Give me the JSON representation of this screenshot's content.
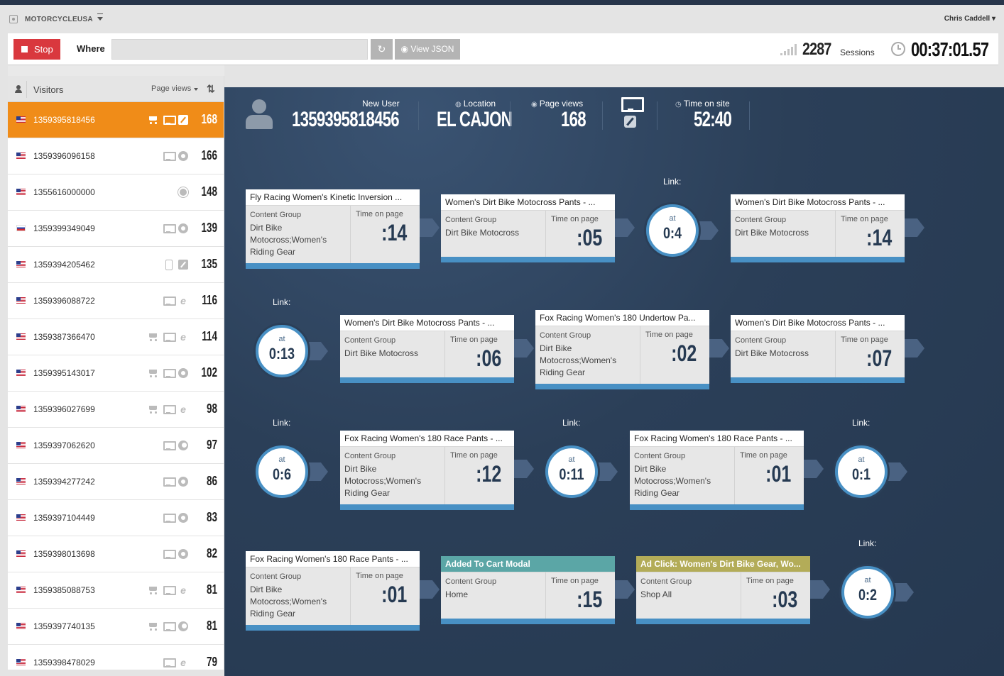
{
  "app": {
    "site_name": "MOTORCYCLEUSA",
    "user_name": "Chris Caddell ▾"
  },
  "controls": {
    "stop_label": "Stop",
    "where_label": "Where",
    "where_value": "",
    "view_json_label": "View JSON",
    "sessions_count": "2287",
    "sessions_label": "Sessions",
    "elapsed": "00:37:01.57"
  },
  "sidebar": {
    "title": "Visitors",
    "sort_label": "Page views",
    "order_icon": "⇅",
    "visitors": [
      {
        "id": "1359395818456",
        "flag": "us",
        "icons": [
          "cart-icon",
          "desktop-icon",
          "safari-icon"
        ],
        "count": "168"
      },
      {
        "id": "1359396096158",
        "flag": "us",
        "icons": [
          "desktop-icon",
          "chrome-icon"
        ],
        "count": "166"
      },
      {
        "id": "1355616000000",
        "flag": "us",
        "icons": [
          "gear-icon"
        ],
        "count": "148"
      },
      {
        "id": "1359399349049",
        "flag": "ru",
        "icons": [
          "desktop-icon",
          "chrome-icon"
        ],
        "count": "139"
      },
      {
        "id": "1359394205462",
        "flag": "us",
        "icons": [
          "tablet-icon",
          "safari-icon"
        ],
        "count": "135"
      },
      {
        "id": "1359396088722",
        "flag": "us",
        "icons": [
          "desktop-icon",
          "ie-icon"
        ],
        "count": "116"
      },
      {
        "id": "1359387366470",
        "flag": "us",
        "icons": [
          "cart-icon",
          "desktop-icon",
          "ie-icon"
        ],
        "count": "114"
      },
      {
        "id": "1359395143017",
        "flag": "us",
        "icons": [
          "cart-icon",
          "desktop-icon",
          "chrome-icon"
        ],
        "count": "102"
      },
      {
        "id": "1359396027699",
        "flag": "us",
        "icons": [
          "cart-icon",
          "desktop-icon",
          "ie-icon"
        ],
        "count": "98"
      },
      {
        "id": "1359397062620",
        "flag": "us",
        "icons": [
          "desktop-icon",
          "firefox-icon"
        ],
        "count": "97"
      },
      {
        "id": "1359394277242",
        "flag": "us",
        "icons": [
          "desktop-icon",
          "chrome-icon"
        ],
        "count": "86"
      },
      {
        "id": "1359397104449",
        "flag": "us",
        "icons": [
          "desktop-icon",
          "chrome-icon"
        ],
        "count": "83"
      },
      {
        "id": "1359398013698",
        "flag": "us",
        "icons": [
          "desktop-icon",
          "chrome-icon"
        ],
        "count": "82"
      },
      {
        "id": "1359385088753",
        "flag": "us",
        "icons": [
          "cart-icon",
          "desktop-icon",
          "ie-icon"
        ],
        "count": "81"
      },
      {
        "id": "1359397740135",
        "flag": "us",
        "icons": [
          "cart-icon",
          "desktop-icon",
          "firefox-icon"
        ],
        "count": "81"
      },
      {
        "id": "1359398478029",
        "flag": "us",
        "icons": [
          "desktop-icon",
          "ie-icon"
        ],
        "count": "79"
      }
    ]
  },
  "profile": {
    "user_type_label": "New User",
    "user_id": "1359395818456",
    "location_label": "Location",
    "location": "EL CAJON",
    "pageviews_label": "Page views",
    "pageviews": "168",
    "time_label": "Time on site",
    "time_on_site": "52:40"
  },
  "journey": {
    "content_group_label": "Content Group",
    "time_on_page_label": "Time on page",
    "link_label": "Link:",
    "at_label": "at",
    "steps": [
      {
        "kind": "page",
        "title": "Fly Racing Women's Kinetic Inversion ...",
        "group": "Dirt Bike Motocross;Women's Riding Gear",
        "time": ":14"
      },
      {
        "kind": "page",
        "title": "Women's Dirt Bike Motocross Pants - ...",
        "group": "Dirt Bike Motocross",
        "time": ":05"
      },
      {
        "kind": "link",
        "at": "0:4"
      },
      {
        "kind": "page",
        "title": "Women's Dirt Bike Motocross Pants - ...",
        "group": "Dirt Bike Motocross",
        "time": ":14"
      },
      {
        "kind": "link",
        "at": "0:13"
      },
      {
        "kind": "page",
        "title": "Women's Dirt Bike Motocross Pants - ...",
        "group": "Dirt Bike Motocross",
        "time": ":06"
      },
      {
        "kind": "page",
        "title": "Fox Racing Women's 180 Undertow Pa...",
        "group": "Dirt Bike Motocross;Women's Riding Gear",
        "time": ":02"
      },
      {
        "kind": "page",
        "title": "Women's Dirt Bike Motocross Pants - ...",
        "group": "Dirt Bike Motocross",
        "time": ":07"
      },
      {
        "kind": "link",
        "at": "0:6"
      },
      {
        "kind": "page",
        "title": "Fox Racing Women's 180 Race Pants - ...",
        "group": "Dirt Bike Motocross;Women's Riding Gear",
        "time": ":12"
      },
      {
        "kind": "link",
        "at": "0:11"
      },
      {
        "kind": "page",
        "title": "Fox Racing Women's 180 Race Pants - ...",
        "group": "Dirt Bike Motocross;Women's Riding Gear",
        "time": ":01"
      },
      {
        "kind": "link",
        "at": "0:1"
      },
      {
        "kind": "page",
        "title": "Fox Racing Women's 180 Race Pants - ...",
        "group": "Dirt Bike Motocross;Women's Riding Gear",
        "time": ":01"
      },
      {
        "kind": "page",
        "title": "Added To Cart Modal",
        "style": "teal",
        "group": "Home",
        "time": ":15"
      },
      {
        "kind": "page",
        "title": "Ad Click: Women's Dirt Bike Gear, Wo...",
        "style": "olive",
        "group": "Shop All",
        "time": ":03"
      },
      {
        "kind": "link",
        "at": "0:2"
      }
    ]
  },
  "colors": {
    "accent_orange": "#f08c18",
    "stop_red": "#d9383e",
    "card_blue": "#4890c4",
    "teal_header": "#5ba6a6",
    "olive_header": "#b3ac58",
    "background": "#2b3f58"
  }
}
